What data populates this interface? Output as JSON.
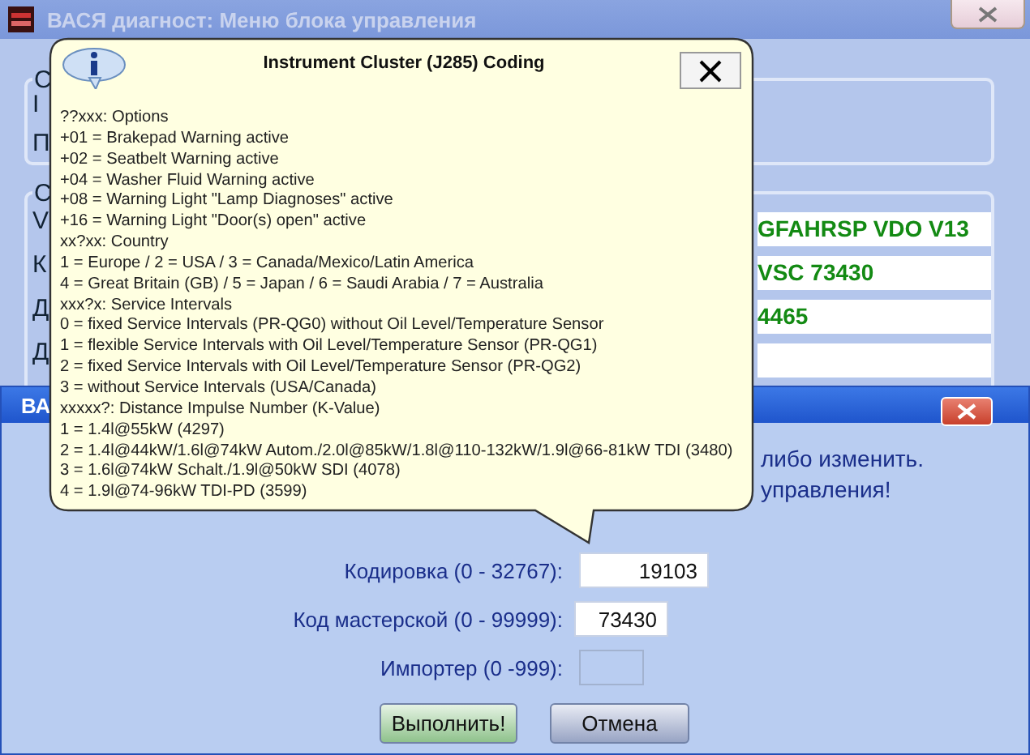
{
  "main_window": {
    "title": "ВАСЯ диагност: Меню блока управления",
    "group_1": {
      "caption": "С",
      "labels": [
        "I",
        "П"
      ]
    },
    "group_2": {
      "caption": "С",
      "rows": [
        {
          "label": "V",
          "value": "GFAHRSP VDO V13"
        },
        {
          "label": "К",
          "value": "VSC 73430"
        },
        {
          "label": "Д",
          "value": "4465"
        },
        {
          "label": "Д"
        }
      ]
    }
  },
  "dialog": {
    "title": "ВА",
    "message_lines": [
      "либо изменить.",
      "управления!"
    ],
    "fields": [
      {
        "label": "Кодировка (0 - 32767):",
        "value": "19103",
        "disabled": false
      },
      {
        "label": "Код мастерской (0 - 99999):",
        "value": "73430",
        "disabled": false
      },
      {
        "label": "Импортер (0 -999):",
        "disabled": true
      }
    ],
    "buttons": [
      {
        "label": "Выполнить!",
        "kind": "primary"
      },
      {
        "label": "Отмена",
        "kind": "secondary"
      }
    ]
  },
  "tooltip": {
    "title": "Instrument Cluster (J285) Coding",
    "lines": [
      "??xxx: Options",
      "+01 = Brakepad Warning active",
      "+02 = Seatbelt Warning active",
      "+04 = Washer Fluid Warning active",
      "+08 = Warning Light \"Lamp Diagnoses\" active",
      "+16 = Warning Light \"Door(s) open\" active",
      "xx?xx: Country",
      "1 = Europe / 2 = USA / 3 = Canada/Mexico/Latin America",
      "4 = Great Britain (GB) / 5 = Japan / 6 = Saudi Arabia / 7 = Australia",
      "xxx?x: Service Intervals",
      "0 = fixed Service Intervals (PR-QG0) without Oil Level/Temperature Sensor",
      "1 = flexible Service Intervals with Oil Level/Temperature Sensor (PR-QG1)",
      "2 = fixed Service Intervals with Oil Level/Temperature Sensor (PR-QG2)",
      "3 = without Service Intervals (USA/Canada)",
      "xxxxx?: Distance Impulse Number (K-Value)",
      "1 = 1.4l@55kW (4297)",
      "2 = 1.4l@44kW/1.6l@74kW Autom./2.0l@85kW/1.8l@110-132kW/1.9l@66-81kW TDI (3480)",
      "3 = 1.6l@74kW Schalt./1.9l@50kW SDI (4078)",
      "4 = 1.9l@74-96kW TDI-PD (3599)"
    ]
  }
}
